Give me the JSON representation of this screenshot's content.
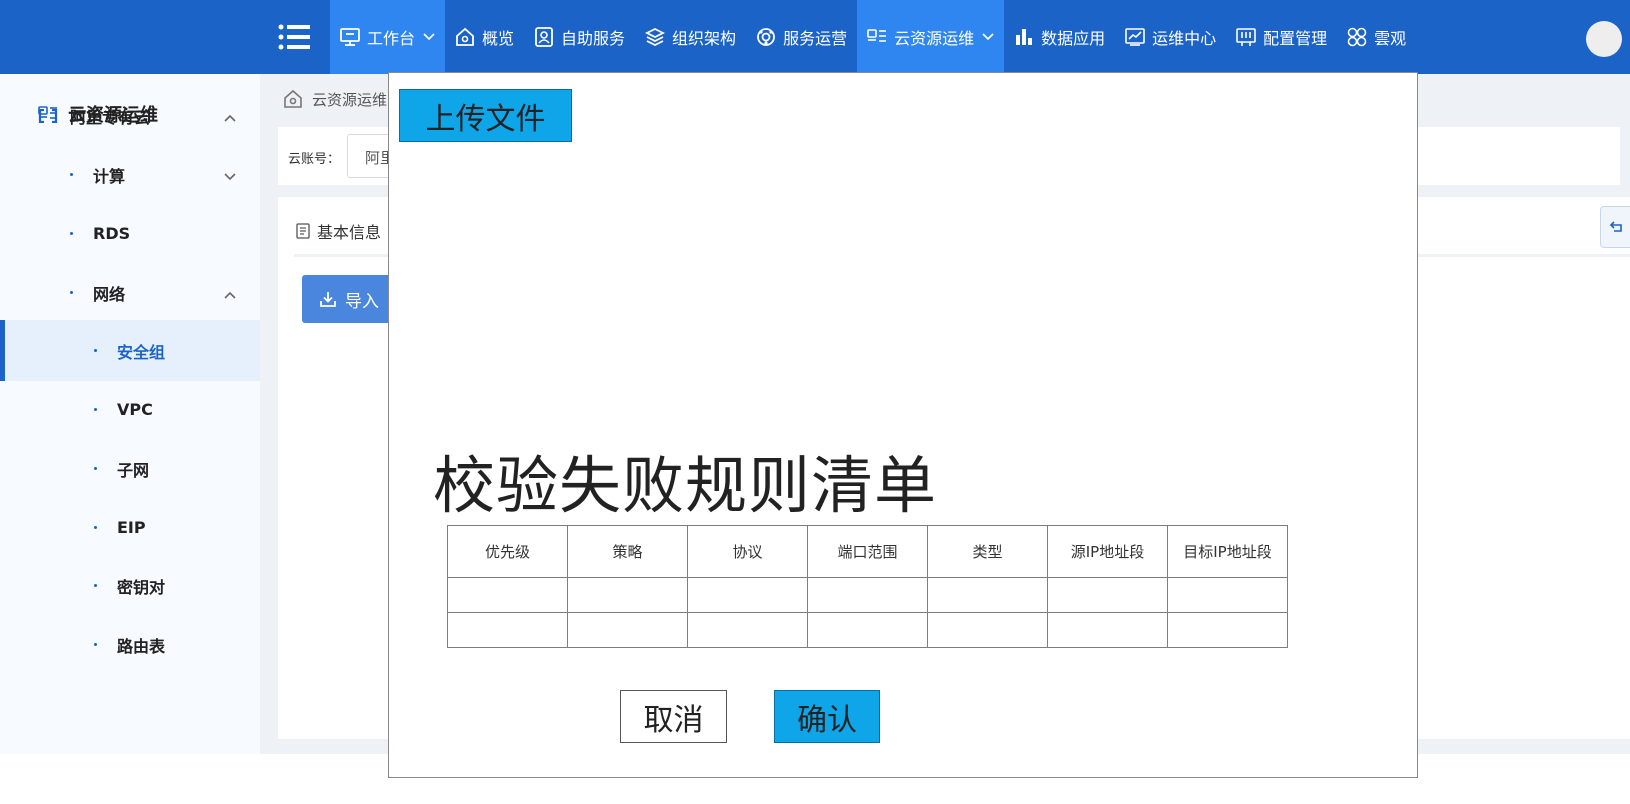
{
  "colors": {
    "topbar": "#1c63c8",
    "nav_active": "#2f86f1",
    "sidebar_bg": "#f7faff",
    "sidebar_active_bg": "#e6f0fd",
    "modal_button": "#0ea5e9",
    "import_button": "#4a86dd"
  },
  "topnav": {
    "items": [
      {
        "label": "工作台",
        "icon": "monitor-icon",
        "active": true,
        "dropdown": true
      },
      {
        "label": "概览",
        "icon": "home-icon"
      },
      {
        "label": "自助服务",
        "icon": "user-card-icon"
      },
      {
        "label": "组织架构",
        "icon": "layers-icon"
      },
      {
        "label": "服务运营",
        "icon": "gear-ring-icon"
      },
      {
        "label": "云资源运维",
        "icon": "id-card-icon",
        "active": true,
        "dropdown": true
      },
      {
        "label": "数据应用",
        "icon": "bar-chart-icon"
      },
      {
        "label": "运维中心",
        "icon": "line-chart-icon"
      },
      {
        "label": "配置管理",
        "icon": "config-panel-icon"
      },
      {
        "label": "雲观",
        "icon": "grid-clover-icon"
      }
    ]
  },
  "sidebar": {
    "title": "云资源运维",
    "items": [
      {
        "label": "阿里专有云",
        "level": 0,
        "expanded": true
      },
      {
        "label": "计算",
        "level": 1,
        "expanded": false
      },
      {
        "label": "RDS",
        "level": 1
      },
      {
        "label": "网络",
        "level": 1,
        "expanded": true
      },
      {
        "label": "安全组",
        "level": 2,
        "active": true
      },
      {
        "label": "VPC",
        "level": 2
      },
      {
        "label": "子网",
        "level": 2
      },
      {
        "label": "EIP",
        "level": 2
      },
      {
        "label": "密钥对",
        "level": 2
      },
      {
        "label": "路由表",
        "level": 2
      }
    ]
  },
  "breadcrumb": {
    "text": "云资源运维"
  },
  "filter": {
    "label": "云账号：",
    "value": "阿里"
  },
  "tabs": {
    "basic_info": "基本信息"
  },
  "toolbar": {
    "import_label": "导入"
  },
  "modal": {
    "upload_label": "上传文件",
    "title": "校验失败规则清单",
    "table": {
      "columns": [
        "优先级",
        "策略",
        "协议",
        "端口范围",
        "类型",
        "源IP地址段",
        "目标IP地址段"
      ],
      "rows": [
        [
          "",
          "",
          "",
          "",
          "",
          "",
          ""
        ],
        [
          "",
          "",
          "",
          "",
          "",
          "",
          ""
        ]
      ]
    },
    "cancel_label": "取消",
    "confirm_label": "确认"
  }
}
